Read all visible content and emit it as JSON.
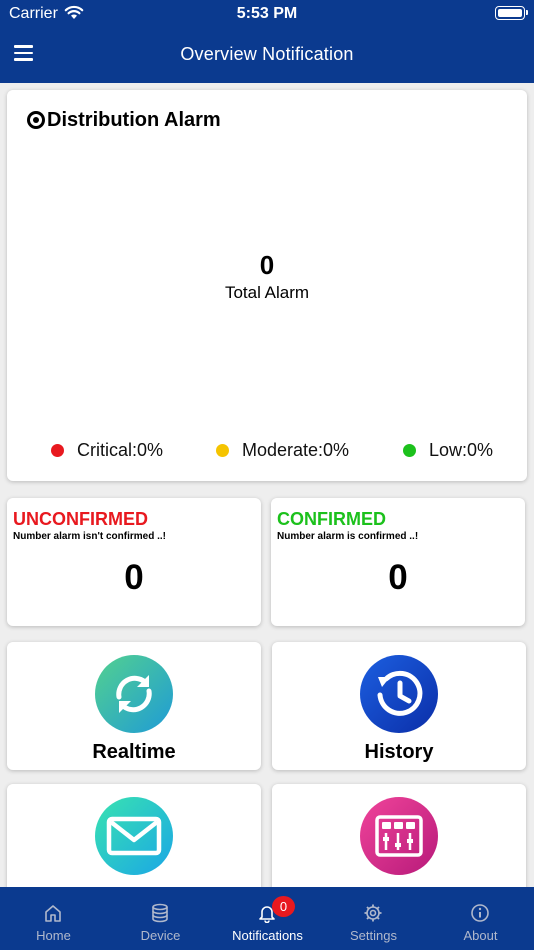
{
  "status_bar": {
    "carrier": "Carrier",
    "time": "5:53 PM"
  },
  "header": {
    "title": "Overview Notification",
    "menu_icon": "hamburger-menu-icon"
  },
  "distribution": {
    "title": "Distribution Alarm",
    "total_value": "0",
    "total_label": "Total Alarm",
    "legend": [
      {
        "label": "Critical:0%",
        "color": "#e8191f"
      },
      {
        "label": "Moderate:0%",
        "color": "#f5c400"
      },
      {
        "label": "Low:0%",
        "color": "#1cc11c"
      }
    ]
  },
  "unconfirmed": {
    "title": "UNCONFIRMED",
    "subtitle": "Number alarm isn't confirmed ..!",
    "value": "0",
    "color": "#e8191f"
  },
  "confirmed": {
    "title": "CONFIRMED",
    "subtitle": "Number alarm is confirmed ..!",
    "value": "0",
    "color": "#1cc11c"
  },
  "tiles": [
    {
      "label": "Realtime",
      "icon": "refresh-icon"
    },
    {
      "label": "History",
      "icon": "history-clock-icon"
    },
    {
      "label": "",
      "icon": "mail-icon"
    },
    {
      "label": "",
      "icon": "mixer-panel-icon"
    }
  ],
  "tabbar": {
    "tabs": [
      {
        "label": "Home",
        "icon": "home-icon"
      },
      {
        "label": "Device",
        "icon": "database-icon"
      },
      {
        "label": "Notifications",
        "icon": "bell-icon",
        "badge": "0"
      },
      {
        "label": "Settings",
        "icon": "gear-icon"
      },
      {
        "label": "About",
        "icon": "info-icon"
      }
    ],
    "active": "Notifications"
  }
}
